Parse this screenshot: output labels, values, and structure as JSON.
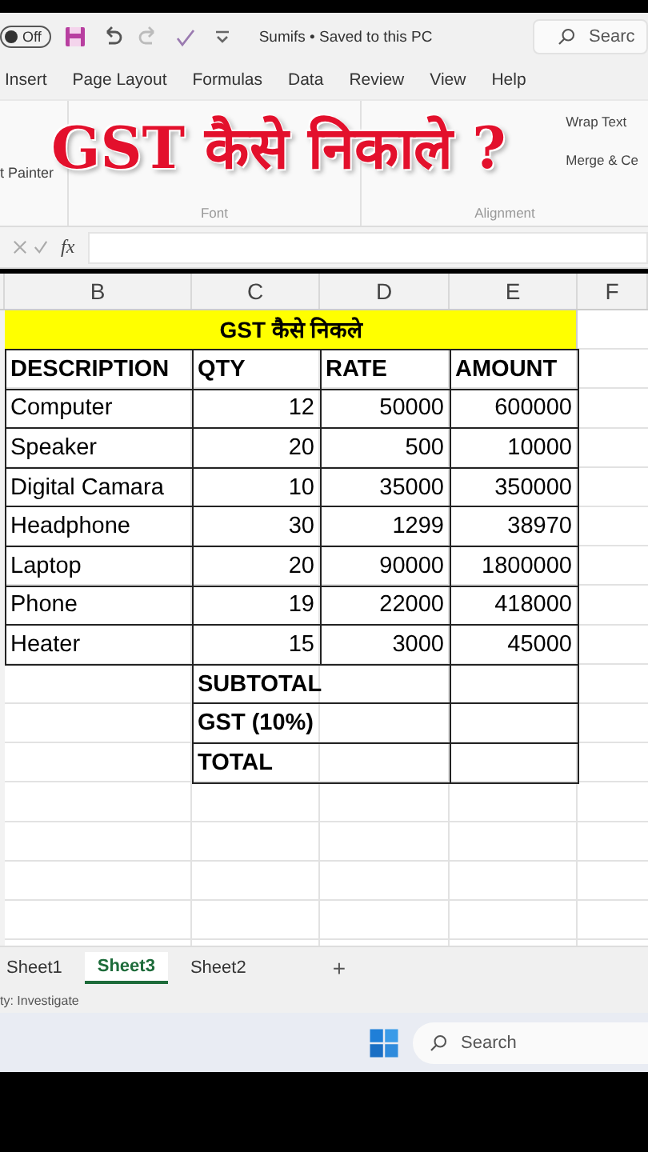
{
  "title_bar": {
    "autosave": "Off",
    "file": "Sumifs • Saved to this PC",
    "search": "Searc"
  },
  "menu": [
    "Insert",
    "Page Layout",
    "Formulas",
    "Data",
    "Review",
    "View",
    "Help"
  ],
  "ribbon": {
    "format_painter": "t Painter",
    "wrap_text": "Wrap Text",
    "merge": "Merge & Ce",
    "groups": [
      "Font",
      "Alignment"
    ]
  },
  "formula_bar": {
    "function": "fx"
  },
  "overlay_title": "GST कैसे निकाले ?",
  "columns": [
    "B",
    "C",
    "D",
    "E",
    "F"
  ],
  "sheet": {
    "title": "GST कैसे निकले",
    "header": [
      "DESCRIPTION",
      "QTY",
      "RATE",
      "AMOUNT"
    ],
    "rows": [
      [
        "Computer",
        "12",
        "50000",
        "600000"
      ],
      [
        "Speaker",
        "20",
        "500",
        "10000"
      ],
      [
        "Digital Camara",
        "10",
        "35000",
        "350000"
      ],
      [
        "Headphone",
        "30",
        "1299",
        "38970"
      ],
      [
        "Laptop",
        "20",
        "90000",
        "1800000"
      ],
      [
        "Phone",
        "19",
        "22000",
        "418000"
      ],
      [
        "Heater",
        "15",
        "3000",
        "45000"
      ]
    ],
    "summary": [
      "SUBTOTAL",
      "GST (10%)",
      "TOTAL"
    ]
  },
  "sheet_tabs": [
    {
      "label": "Sheet1",
      "selected": false
    },
    {
      "label": "Sheet3",
      "selected": true
    },
    {
      "label": "Sheet2",
      "selected": false
    }
  ],
  "add_sheet": "+",
  "status": "ty: Investigate",
  "taskbar": {
    "search": "Search"
  }
}
